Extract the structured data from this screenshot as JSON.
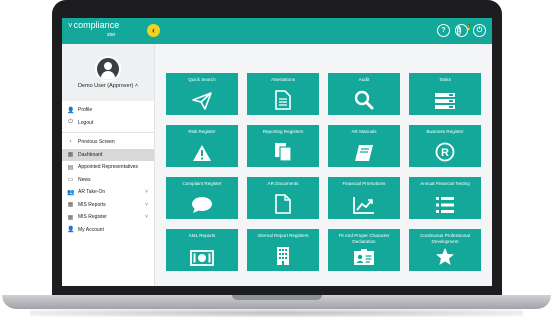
{
  "app": {
    "logo_main": "compliance",
    "logo_sub": "star",
    "logo_chevron": "˅",
    "collapse_glyph": "‹"
  },
  "topbar_icons": [
    {
      "name": "help-icon",
      "glyph": "?"
    },
    {
      "name": "notification-icon",
      "glyph": "!",
      "badge": "0"
    },
    {
      "name": "power-icon",
      "glyph": "⏻"
    }
  ],
  "user": {
    "name": "Demo User (Approver)",
    "caret": "˄"
  },
  "sidebar": {
    "top_items": [
      {
        "label": "Profile",
        "icon": "user-icon",
        "glyph": "👤"
      },
      {
        "label": "Logout",
        "icon": "power-icon",
        "glyph": "⏻"
      }
    ],
    "items": [
      {
        "label": "Previous Screen",
        "icon": "chevron-left-icon",
        "glyph": "‹",
        "caret": ""
      },
      {
        "label": "Dashboard",
        "icon": "dashboard-icon",
        "glyph": "▦",
        "caret": "",
        "active": true
      },
      {
        "label": "Appointed Representatives",
        "icon": "list-icon",
        "glyph": "▤",
        "caret": ""
      },
      {
        "label": "News",
        "icon": "news-icon",
        "glyph": "▭",
        "caret": ""
      },
      {
        "label": "AR Take-On",
        "icon": "users-icon",
        "glyph": "👥",
        "caret": "˅"
      },
      {
        "label": "MIS Reports",
        "icon": "reports-icon",
        "glyph": "▦",
        "caret": "˅"
      },
      {
        "label": "MIS Register",
        "icon": "register-icon",
        "glyph": "▦",
        "caret": "˅"
      },
      {
        "label": "My Account",
        "icon": "account-icon",
        "glyph": "👤",
        "caret": ""
      }
    ]
  },
  "tiles": [
    {
      "label": "Quick Search",
      "icon": "paper-plane-icon"
    },
    {
      "label": "Attestations",
      "icon": "document-icon"
    },
    {
      "label": "Audit",
      "icon": "search-icon"
    },
    {
      "label": "Tasks",
      "icon": "tasks-icon"
    },
    {
      "label": "Risk Register",
      "icon": "warning-icon"
    },
    {
      "label": "Reporting Registers",
      "icon": "copy-icon"
    },
    {
      "label": "AR Manuals",
      "icon": "book-icon"
    },
    {
      "label": "Business Register",
      "icon": "registered-icon"
    },
    {
      "label": "Complaint Register",
      "icon": "comment-icon"
    },
    {
      "label": "AR Documents",
      "icon": "file-icon"
    },
    {
      "label": "Financial Promotions",
      "icon": "chart-line-icon"
    },
    {
      "label": "Annual Financial Testing",
      "icon": "list-icon"
    },
    {
      "label": "AML Reports",
      "icon": "money-icon"
    },
    {
      "label": "Internal Report Registers",
      "icon": "building-icon"
    },
    {
      "label": "Fit And Proper Character Declaration",
      "icon": "id-card-icon"
    },
    {
      "label": "Continuous Professional Development",
      "icon": "star-icon"
    }
  ],
  "colors": {
    "teal": "#14a89a",
    "accent": "#f2d21e"
  }
}
